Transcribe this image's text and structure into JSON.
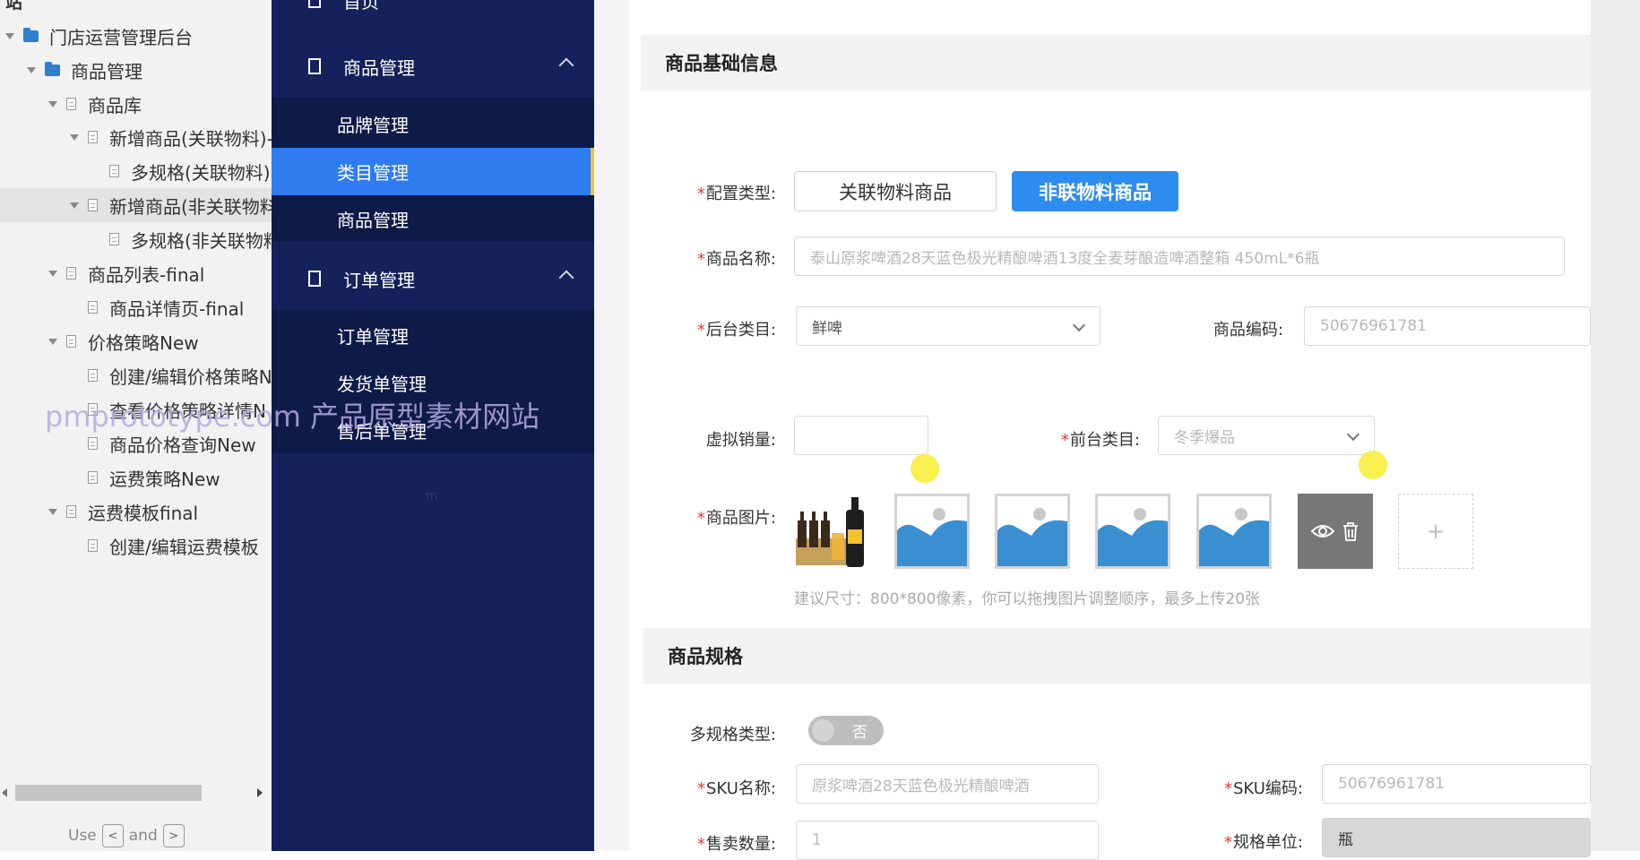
{
  "tree": {
    "cut_title": "站",
    "items": [
      {
        "label": "门店运营管理后台",
        "kind": "folder",
        "caret": true
      },
      {
        "label": "商品管理",
        "kind": "folder",
        "caret": true
      },
      {
        "label": "商品库",
        "kind": "page",
        "caret": true
      },
      {
        "label": "新增商品(关联物料)-",
        "kind": "page",
        "caret": true
      },
      {
        "label": "多规格(关联物料)",
        "kind": "page",
        "caret": false
      },
      {
        "label": "新增商品(非关联物料",
        "kind": "page",
        "caret": true
      },
      {
        "label": "多规格(非关联物料",
        "kind": "page",
        "caret": false
      },
      {
        "label": "商品列表-final",
        "kind": "page",
        "caret": true
      },
      {
        "label": "商品详情页-final",
        "kind": "page",
        "caret": false
      },
      {
        "label": "价格策略New",
        "kind": "page",
        "caret": true
      },
      {
        "label": "创建/编辑价格策略N",
        "kind": "page",
        "caret": false
      },
      {
        "label": "查看价格策略详情N",
        "kind": "page",
        "caret": false
      },
      {
        "label": "商品价格查询New",
        "kind": "page",
        "caret": false
      },
      {
        "label": "运费策略New",
        "kind": "page",
        "caret": false
      },
      {
        "label": "运费模板final",
        "kind": "page",
        "caret": true
      },
      {
        "label": "创建/编辑运费模板",
        "kind": "page",
        "caret": false
      }
    ],
    "hint": {
      "use": "Use",
      "and": "and",
      "key1": "<",
      "key2": ">"
    }
  },
  "watermark": "pmprototype.com 产品原型素材网站",
  "nav": {
    "top_partial": "首页",
    "groups": [
      {
        "label": "商品管理",
        "items": [
          "品牌管理",
          "类目管理",
          "商品管理"
        ]
      },
      {
        "label": "订单管理",
        "items": [
          "订单管理",
          "发货单管理",
          "售后单管理"
        ]
      }
    ],
    "active_item": "类目管理",
    "faint_text": "m"
  },
  "form": {
    "section_basic": "商品基础信息",
    "config_type": {
      "label": "配置类型:",
      "options": [
        "关联物料商品",
        "非联物料商品"
      ],
      "selected": "非联物料商品"
    },
    "product_name": {
      "label": "商品名称:",
      "placeholder": "泰山原浆啤酒28天蓝色极光精酿啤酒13度全麦芽酿造啤酒整箱 450mL*6瓶"
    },
    "backend_category": {
      "label": "后台类目:",
      "value": "鲜啤"
    },
    "product_code": {
      "label": "商品编码:",
      "value": "50676961781"
    },
    "virtual_sales": {
      "label": "虚拟销量:",
      "value": ""
    },
    "frontend_category": {
      "label": "前台类目:",
      "value": "冬季爆品"
    },
    "images": {
      "label": "商品图片:",
      "hint": "建议尺寸：800*800像素，你可以拖拽图片调整顺序，最多上传20张",
      "add": "+"
    },
    "section_spec": "商品规格",
    "multi_spec": {
      "label": "多规格类型:",
      "toggle": "否"
    },
    "sku_name": {
      "label": "SKU名称:",
      "value": "原浆啤酒28天蓝色极光精酿啤酒"
    },
    "sku_code": {
      "label": "SKU编码:",
      "value": "50676961781"
    },
    "sale_qty": {
      "label": "售卖数量:",
      "value": "1"
    },
    "spec_unit": {
      "label": "规格单位:",
      "value": "瓶"
    }
  },
  "colors": {
    "nav_bg": "#14215a",
    "nav_active": "#2f7cf0",
    "primary": "#2d8cf0",
    "required": "#e33333",
    "highlight_dot": "#f6ee3c"
  }
}
